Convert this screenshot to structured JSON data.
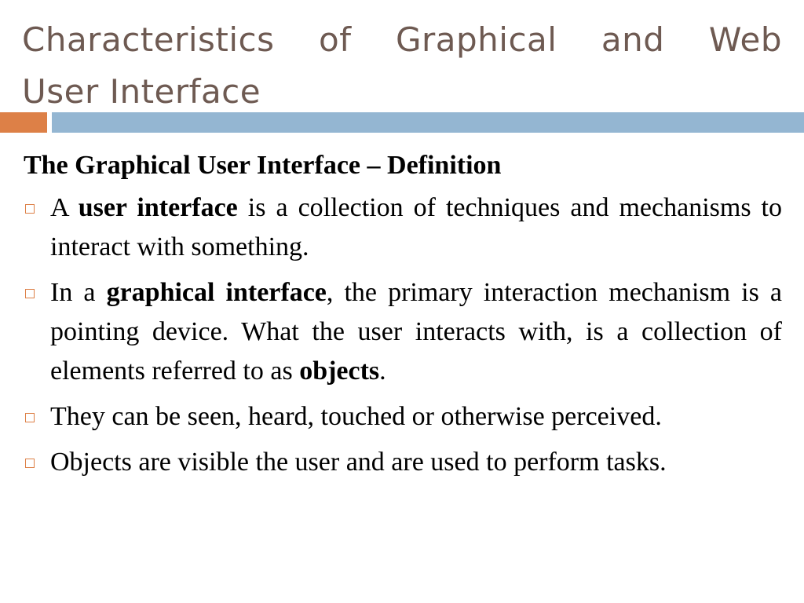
{
  "slide": {
    "title_line1": "Characteristics of Graphical and Web",
    "title_line2": "User Interface",
    "colors": {
      "title": "#6e5a52",
      "accent": "#dd8047",
      "bar": "#94b6d2"
    },
    "subheading": "The Graphical User Interface – Definition",
    "bullets": [
      {
        "pre": "A ",
        "bold": "user interface",
        "post": " is a collection of  techniques and mechanisms to interact with something.",
        "bold2": "",
        "post2": ""
      },
      {
        "pre": "In a ",
        "bold": "graphical interface",
        "post": ", the primary interaction mechanism is a pointing device. What the user interacts with, is a collection of elements referred to as ",
        "bold2": "objects",
        "post2": "."
      },
      {
        "pre": "They can be seen, heard, touched or otherwise perceived.",
        "bold": "",
        "post": "",
        "bold2": "",
        "post2": ""
      },
      {
        "pre": "Objects are visible the user and are used to perform tasks.",
        "bold": "",
        "post": "",
        "bold2": "",
        "post2": ""
      }
    ],
    "bullet_icon": "hollow-square-icon"
  }
}
